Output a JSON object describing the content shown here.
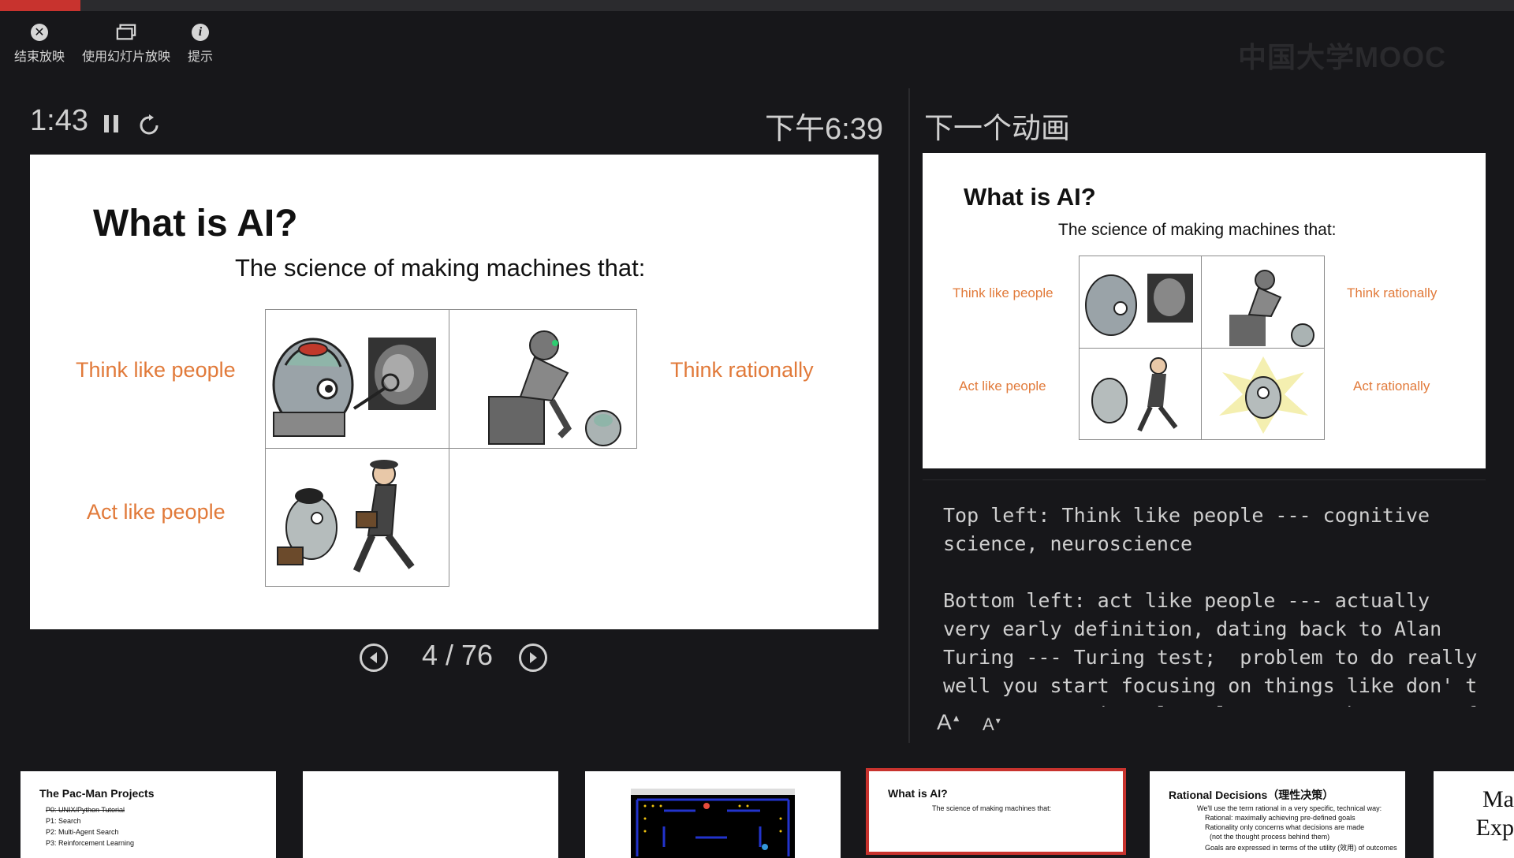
{
  "progress_percent": 5.3,
  "toolbar": {
    "end_show": "结束放映",
    "use_slideshow": "使用幻灯片放映",
    "hint": "提示"
  },
  "watermark": "中国大学MOOC",
  "timer": "1:43",
  "clock": "下午6:39",
  "current_slide": {
    "title": "What is AI?",
    "subtitle": "The science of making machines that:",
    "think_like_people": "Think like people",
    "think_rationally": "Think rationally",
    "act_like_people": "Act like people"
  },
  "navigation": {
    "page": "4 / 76"
  },
  "next": {
    "label": "下一个动画",
    "title": "What is AI?",
    "subtitle": "The science of making machines that:",
    "think_like_people": "Think like people",
    "think_rationally": "Think rationally",
    "act_like_people": "Act like people",
    "act_rationally": "Act rationally"
  },
  "notes": {
    "text": "Top left: Think like people --- cognitive\nscience, neuroscience\n\nBottom left: act like people --- actually\nvery early definition, dating back to Alan\nTuring --- Turing test;  problem to do really\nwell you start focusing on things like don' t\n   t         i    l    l       t  h     t   f",
    "increase": "A",
    "decrease": "A"
  },
  "thumbnails": [
    {
      "title": "The Pac-Man Projects",
      "lines": [
        "P0: UNIX/Python Tutorial",
        "P1: Search",
        "P2: Multi-Agent Search",
        "P3: Reinforcement Learning"
      ]
    },
    {
      "title": "",
      "lines": []
    },
    {
      "title": "",
      "lines": []
    },
    {
      "title": "What is AI?",
      "lines": [
        "The science of making machines that:"
      ]
    },
    {
      "title": "Rational Decisions（理性决策）",
      "lines": [
        "We'll use the term rational in a very specific, technical way:",
        "Rational: maximally achieving pre-defined goals",
        "Rationality only concerns what decisions are made",
        "(not the thought process behind them)",
        "Goals are expressed in terms of the utility (效用) of outcomes"
      ]
    },
    {
      "title": "Ma\nExp",
      "lines": []
    }
  ],
  "colors": {
    "accent_red": "#c8332e",
    "orange_label": "#e17a3a",
    "background": "#17171a"
  }
}
